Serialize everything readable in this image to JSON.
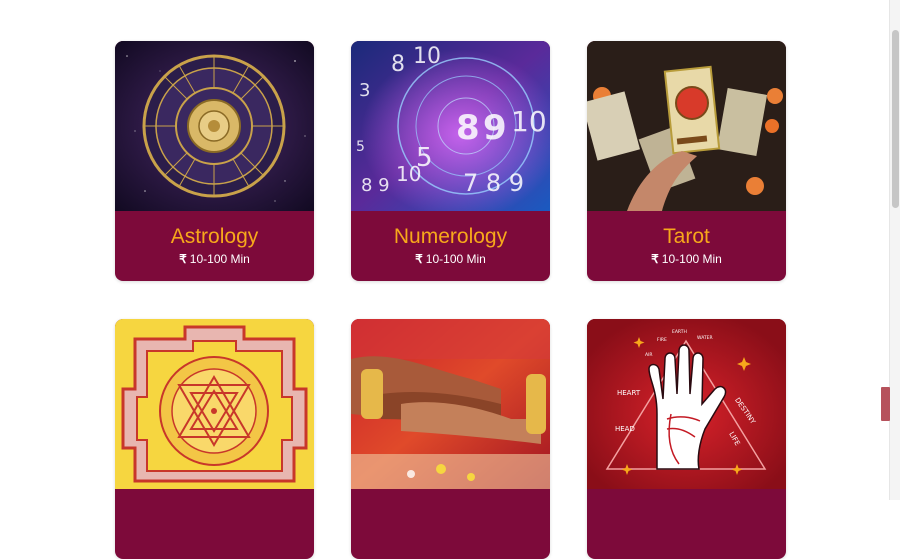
{
  "currency_symbol": "₹",
  "cards": [
    {
      "title": "Astrology",
      "price": "10-100 Min"
    },
    {
      "title": "Numerology",
      "price": "10-100 Min"
    },
    {
      "title": "Tarot",
      "price": "10-100 Min"
    },
    {
      "title": "",
      "price": ""
    },
    {
      "title": "",
      "price": ""
    },
    {
      "title": "",
      "price": ""
    }
  ],
  "palm_labels": {
    "earth": "EARTH",
    "fire": "FIRE",
    "water": "WATER",
    "air": "AIR",
    "heart": "HEART",
    "head": "HEAD",
    "destiny": "DESTINY",
    "life": "LIFE"
  },
  "colors": {
    "card_footer": "#7d0a3a",
    "title_accent": "#f7a81b",
    "price_text": "#ffffff"
  },
  "icons": [
    "zodiac-wheel-image",
    "numerology-image",
    "tarot-image",
    "sri-yantra-image",
    "wedding-hands-image",
    "palmistry-image"
  ]
}
